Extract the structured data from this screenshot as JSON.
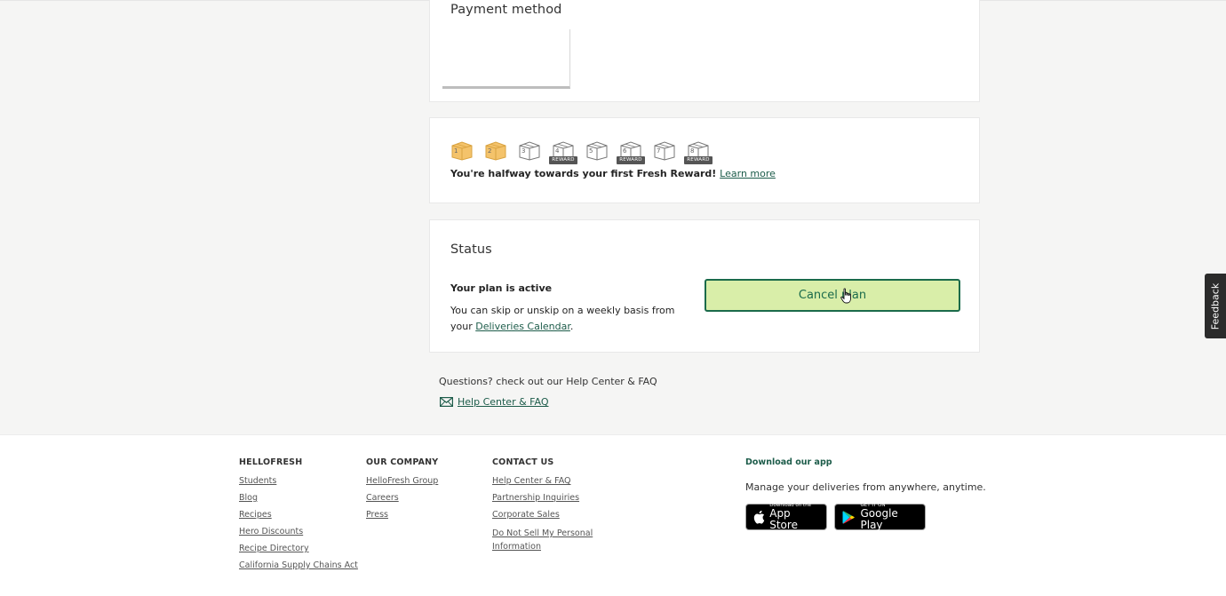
{
  "payment": {
    "title": "Payment method"
  },
  "rewards": {
    "boxes": [
      {
        "num": "1",
        "filled": true,
        "reward": false
      },
      {
        "num": "2",
        "filled": true,
        "reward": false
      },
      {
        "num": "3",
        "filled": false,
        "reward": false
      },
      {
        "num": "4",
        "filled": false,
        "reward": true
      },
      {
        "num": "5",
        "filled": false,
        "reward": false
      },
      {
        "num": "6",
        "filled": false,
        "reward": true
      },
      {
        "num": "7",
        "filled": false,
        "reward": false
      },
      {
        "num": "8",
        "filled": false,
        "reward": true
      }
    ],
    "reward_tag": "REWARD",
    "message": "You're halfway towards your first Fresh Reward!",
    "learn_more": "Learn more"
  },
  "status": {
    "title": "Status",
    "headline": "Your plan is active",
    "text": "You can skip or unskip on a weekly basis from your",
    "calendar_link": "Deliveries Calendar",
    "period": ".",
    "cancel_button": "Cancel plan"
  },
  "help": {
    "question": "Questions? check out our Help Center & FAQ",
    "link": "Help Center & FAQ"
  },
  "feedback": "Feedback",
  "footer": {
    "hellofresh": {
      "heading": "HELLOFRESH",
      "links": [
        "Students",
        "Blog",
        "Recipes",
        "Hero Discounts",
        "Recipe Directory",
        "California Supply Chains Act"
      ]
    },
    "company": {
      "heading": "OUR COMPANY",
      "links": [
        "HelloFresh Group",
        "Careers",
        "Press"
      ]
    },
    "contact": {
      "heading": "CONTACT US",
      "links": [
        "Help Center & FAQ",
        "Partnership Inquiries",
        "Corporate Sales",
        "Do Not Sell My Personal Information"
      ]
    },
    "app": {
      "heading": "Download our app",
      "subtitle": "Manage your deliveries from anywhere, anytime.",
      "appstore_small": "Download on the",
      "appstore_big": "App Store",
      "googleplay_small": "GET IT ON",
      "googleplay_big": "Google Play"
    }
  },
  "colors": {
    "accent": "#1b6b4b",
    "button_bg": "#d9eea9",
    "box_filled": "#f4c36b"
  }
}
